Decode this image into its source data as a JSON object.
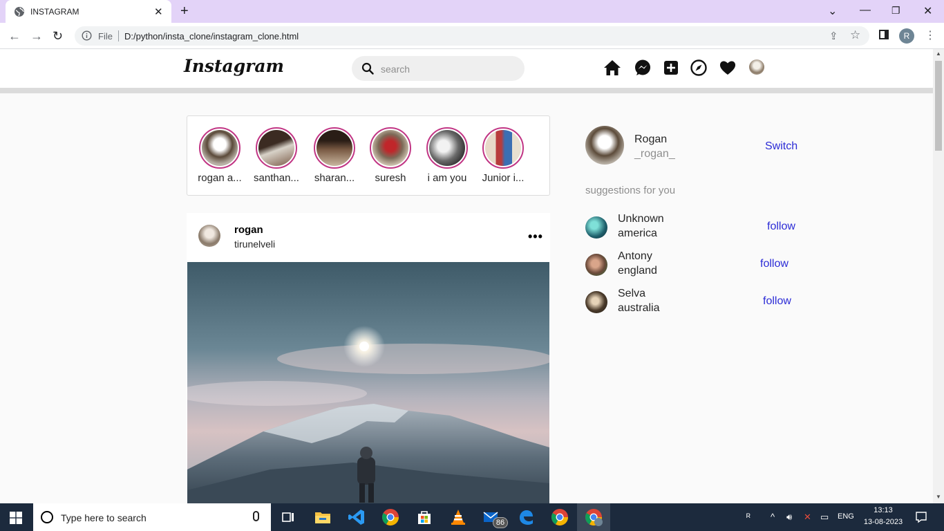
{
  "browser": {
    "tab_title": "INSTAGRAM",
    "omnibox_scheme": "File",
    "url": "D:/python/insta_clone/instagram_clone.html",
    "profile_initial": "R"
  },
  "header": {
    "logo": "Instagram",
    "search_placeholder": "search",
    "nav_icons": [
      "home-icon",
      "messenger-icon",
      "new-post-icon",
      "explore-icon",
      "heart-icon",
      "profile-avatar"
    ]
  },
  "stories": [
    {
      "name": "rogan a..."
    },
    {
      "name": "santhan..."
    },
    {
      "name": "sharan..."
    },
    {
      "name": "suresh"
    },
    {
      "name": "i am you"
    },
    {
      "name": "Junior i..."
    }
  ],
  "post": {
    "username": "rogan",
    "location": "tirunelveli",
    "more": "•••"
  },
  "sidebar": {
    "me_name": "Rogan",
    "me_handle": "_rogan_",
    "switch_label": "Switch",
    "suggestions_title": "suggestions for you",
    "suggestions": [
      {
        "name": "Unknown",
        "location": "america",
        "action": "follow"
      },
      {
        "name": "Antony",
        "location": "england",
        "action": "follow"
      },
      {
        "name": "Selva",
        "location": "australia",
        "action": "follow"
      }
    ]
  },
  "taskbar": {
    "search_placeholder": "Type here to search",
    "mail_badge": "86",
    "language": "ENG",
    "time": "13:13",
    "date": "13-08-2023"
  },
  "colors": {
    "link_blue": "#2b2bd6",
    "story_ring": "#c13584",
    "tab_strip": "#e3d3f8",
    "taskbar": "#1c2a3d"
  }
}
